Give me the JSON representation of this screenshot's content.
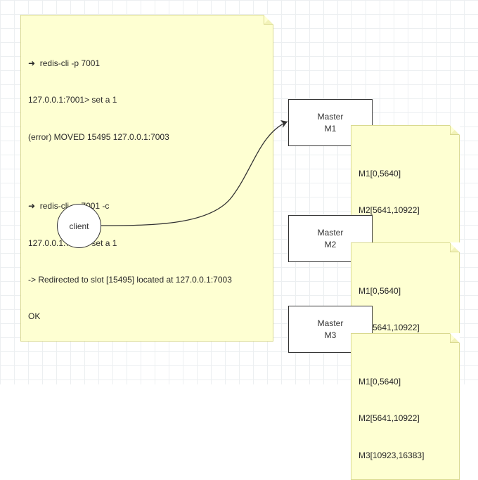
{
  "terminal_note": {
    "line1": "➜  redis-cli -p 7001",
    "line2": "127.0.0.1:7001> set a 1",
    "line3": "(error) MOVED 15495 127.0.0.1:7003",
    "line4": "",
    "line5": "➜  redis-cli -p 7001 -c",
    "line6": "127.0.0.1:7001> set a 1",
    "line7": "-> Redirected to slot [15495] located at 127.0.0.1:7003",
    "line8": "OK"
  },
  "client": {
    "label": "client"
  },
  "masters": {
    "m1": {
      "title": "Master",
      "sub": "M1"
    },
    "m2": {
      "title": "Master",
      "sub": "M2"
    },
    "m3": {
      "title": "Master",
      "sub": "M3"
    }
  },
  "slot_note": {
    "line1": "M1[0,5640]",
    "line2": "M2[5641,10922]",
    "line3": "M3[10923,16383]"
  }
}
